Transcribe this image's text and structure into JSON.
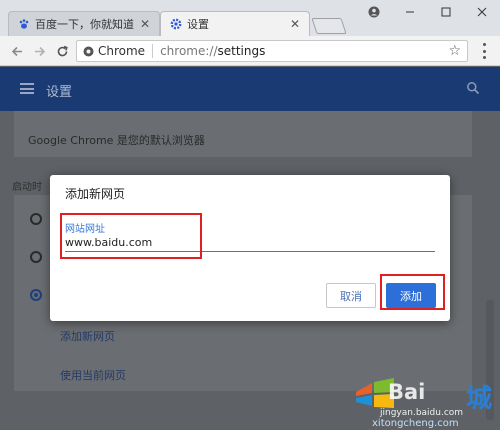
{
  "browser": {
    "tabs": [
      {
        "label": "百度一下，你就知道",
        "icon": "baidu-paw-icon",
        "active": false
      },
      {
        "label": "设置",
        "icon": "gear-icon",
        "active": true
      }
    ],
    "address": {
      "site_label": "Chrome",
      "url_scheme": "chrome://",
      "url_path": "settings"
    }
  },
  "settings": {
    "header_title": "设置",
    "default_browser_text": "Google Chrome 是您的默认浏览器",
    "startup_label": "启动时",
    "add_page_link": "添加新网页",
    "use_current_link": "使用当前网页"
  },
  "dialog": {
    "title": "添加新网页",
    "field_label": "网站网址",
    "field_value": "www.baidu.com",
    "cancel_label": "取消",
    "add_label": "添加"
  },
  "watermark": {
    "brand": "Bai",
    "suffix": "城",
    "url_top": "jingyan.baidu.com",
    "url_bottom": "xitongcheng.com"
  },
  "colors": {
    "header_bg": "#1a3a74",
    "accent": "#2c6fd9",
    "highlight": "#e02020"
  }
}
